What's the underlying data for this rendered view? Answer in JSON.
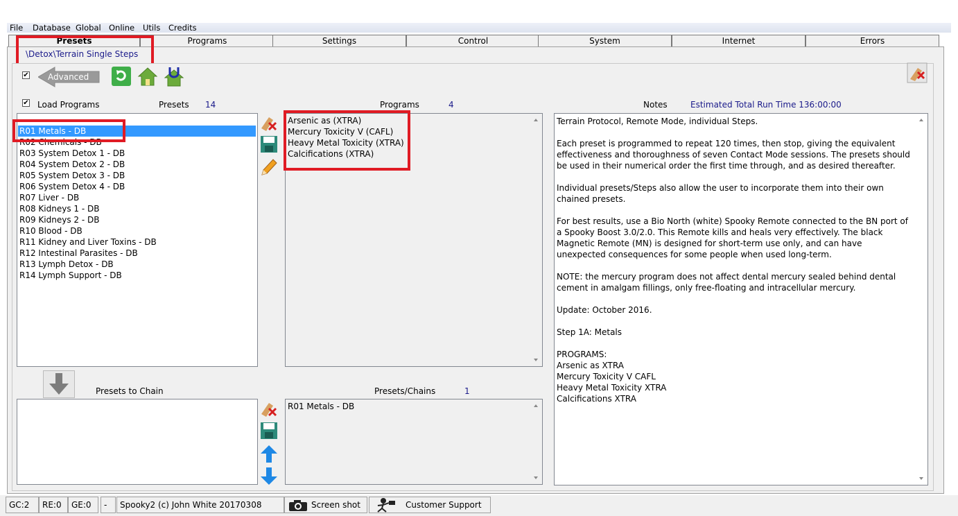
{
  "menu": [
    "File",
    "Database",
    "Global",
    "Online",
    "Utils",
    "Credits"
  ],
  "tabs": [
    "Presets",
    "Programs",
    "Settings",
    "Control",
    "System",
    "Internet",
    "Errors"
  ],
  "breadcrumb": "\\Detox\\Terrain Single Steps",
  "advanced_label": "Advanced",
  "load_programs_label": "Load Programs",
  "presets_label": "Presets",
  "presets_count": "14",
  "programs_label": "Programs",
  "programs_count": "4",
  "notes_label": "Notes",
  "estimated_runtime": "Estimated Total Run Time 136:00:00",
  "presets": [
    "R01 Metals - DB",
    "R02 Chemicals - DB",
    "R03 System Detox 1 - DB",
    "R04 System Detox 2 - DB",
    "R05 System Detox 3 - DB",
    "R06 System Detox 4 - DB",
    "R07 Liver - DB",
    "R08 Kidneys 1 - DB",
    "R09 Kidneys 2 - DB",
    "R10 Blood - DB",
    "R11 Kidney and Liver Toxins - DB",
    "R12 Intestinal Parasites - DB",
    "R13 Lymph Detox - DB",
    "R14 Lymph Support - DB"
  ],
  "programs": [
    "Arsenic as (XTRA)",
    "Mercury Toxicity V (CAFL)",
    "Heavy Metal Toxicity (XTRA)",
    "Calcifications (XTRA)"
  ],
  "notes": "Terrain Protocol, Remote Mode, individual Steps.\n\nEach preset is programmed to repeat 120 times, then stop, giving the equivalent effectiveness and thoroughness of seven Contact Mode sessions. The presets should be used in their numerical order the first time through, and as desired thereafter.\n\nIndividual presets/Steps also allow the user to incorporate them into their own chained presets.\n\nFor best results, use a Bio North (white) Spooky Remote connected to the BN port of a Spooky Boost 3.0/2.0. This Remote kills and heals very effectively. The black Magnetic Remote (MN) is designed for short-term use only, and can have unexpected consequences for some people when used long-term.\n\nNOTE: the mercury program does not affect dental mercury sealed behind dental cement in amalgam fillings, only free-floating and intracellular mercury.\n\nUpdate: October 2016.\n\nStep 1A: Metals\n\nPROGRAMS:\nArsenic as XTRA\nMercury Toxicity V CAFL\nHeavy Metal Toxicity XTRA\nCalcifications XTRA",
  "presets_to_chain_label": "Presets to Chain",
  "presets_chains_label": "Presets/Chains",
  "presets_chains_count": "1",
  "chains": [
    "R01 Metals - DB"
  ],
  "status": {
    "gc": "GC:2",
    "re": "RE:0",
    "ge": "GE:0",
    "dash": "-",
    "copyright": "Spooky2 (c) John White 20170308",
    "screenshot": "Screen shot",
    "support": "Customer Support"
  },
  "colors": {
    "highlight": "#e01b24",
    "selection": "#3399ff",
    "accent": "#1a1a8a"
  }
}
